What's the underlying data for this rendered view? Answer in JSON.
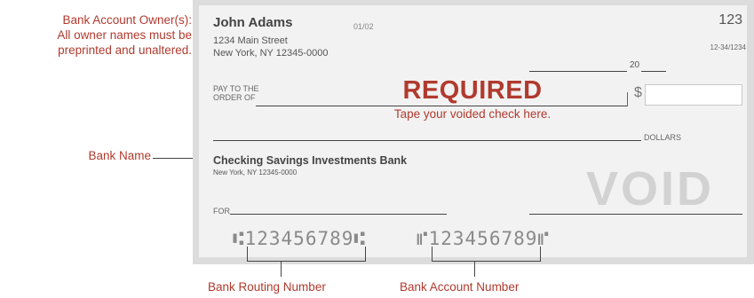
{
  "annotations": {
    "owner_title": "Bank Account Owner(s):",
    "owner_line2": "All owner names must be",
    "owner_line3": "preprinted and unaltered.",
    "bank_name": "Bank Name",
    "routing_number": "Bank Routing Number",
    "account_number": "Bank Account Number"
  },
  "check": {
    "owner_name": "John Adams",
    "owner_street": "1234 Main Street",
    "owner_city": "New York, NY 12345-0000",
    "date_code": "01/02",
    "check_number": "123",
    "fraction_code": "12-34/1234",
    "year_prefix": "20",
    "pay_to_line1": "PAY TO THE",
    "pay_to_line2": "ORDER OF",
    "required": "REQUIRED",
    "tape_instruction": "Tape your voided check here.",
    "dollar_sign": "$",
    "dollars_label": "DOLLARS",
    "bank_name": "Checking Savings Investments Bank",
    "bank_city": "New York, NY 12345-0000",
    "void_stamp": "VOID",
    "for_label": "FOR",
    "micr_routing": "⑆123456789⑆",
    "micr_account": "⑈123456789⑈"
  },
  "colors": {
    "accent_red": "#b03a2e",
    "check_bg": "#f2f2f2",
    "frame": "#dcdcdc"
  }
}
